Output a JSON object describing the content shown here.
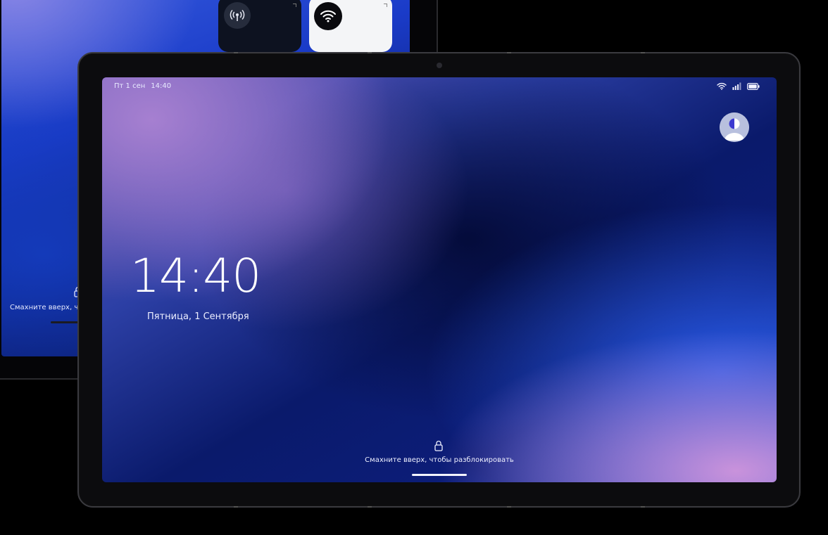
{
  "back_device": {
    "unlock_hint": "Смахните вверх, чтобы разблокировать",
    "quick_settings": [
      {
        "icon": "cellular-broadcast-icon",
        "active": false
      },
      {
        "icon": "wifi-icon",
        "active": true
      }
    ]
  },
  "status_bar": {
    "date_short": "Пт 1 сен",
    "time": "14:40",
    "icons": [
      "wifi-icon",
      "signal-icon",
      "battery-icon"
    ]
  },
  "lock_screen": {
    "clock": "14:40",
    "date_long": "Пятница, 1 Сентября",
    "unlock_hint": "Смахните вверх, чтобы разблокировать"
  },
  "colors": {
    "accent_pink": "#c98fd6",
    "accent_blue": "#1a3bc8",
    "deep_navy": "#06113e"
  }
}
